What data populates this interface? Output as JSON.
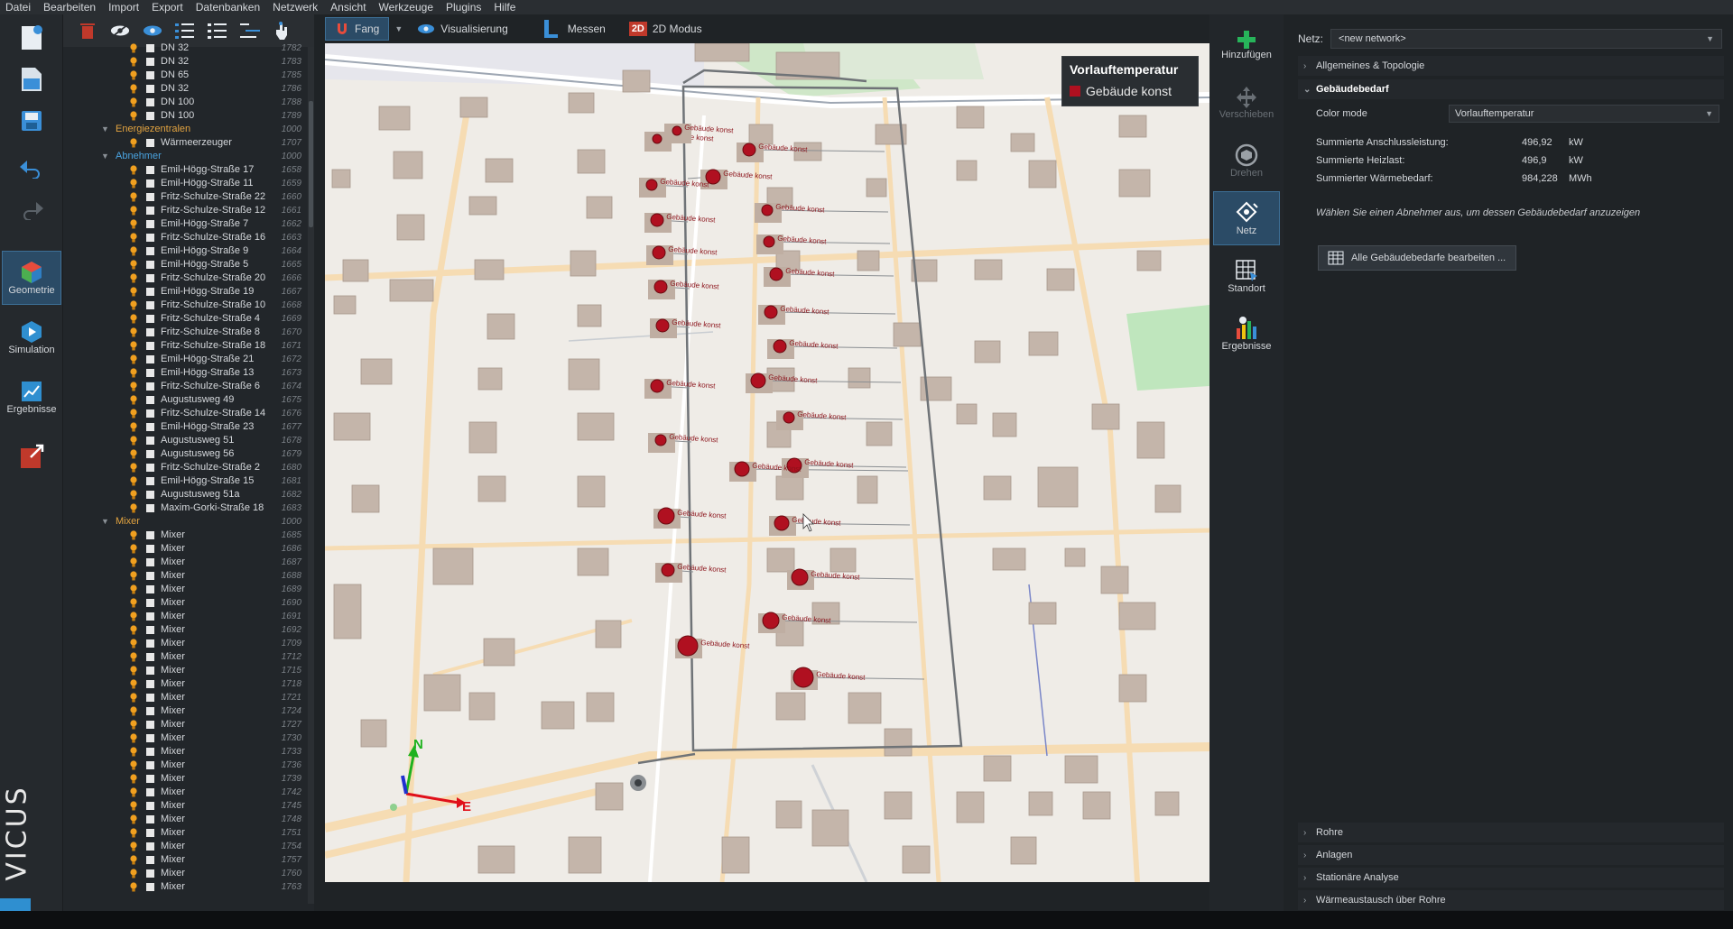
{
  "menu": [
    "Datei",
    "Bearbeiten",
    "Import",
    "Export",
    "Datenbanken",
    "Netzwerk",
    "Ansicht",
    "Werkzeuge",
    "Plugins",
    "Hilfe"
  ],
  "left_modes": [
    {
      "label": "Geometrie",
      "icon": "geometry-icon",
      "active": true
    },
    {
      "label": "Simulation",
      "icon": "simulation-icon",
      "active": false
    },
    {
      "label": "Ergebnisse",
      "icon": "results-icon",
      "active": false
    }
  ],
  "brand": "VICUS",
  "view_toolbar": {
    "fang": "Fang",
    "visualisierung": "Visualisierung",
    "messen": "Messen",
    "modus": "2D Modus",
    "modus_badge": "2D"
  },
  "tree": [
    {
      "type": "item",
      "label": "DN 32",
      "id": "1782"
    },
    {
      "type": "item",
      "label": "DN 32",
      "id": "1783"
    },
    {
      "type": "item",
      "label": "DN 65",
      "id": "1785"
    },
    {
      "type": "item",
      "label": "DN 32",
      "id": "1786"
    },
    {
      "type": "item",
      "label": "DN 100",
      "id": "1788"
    },
    {
      "type": "item",
      "label": "DN 100",
      "id": "1789"
    },
    {
      "type": "group",
      "label": "Energiezentralen",
      "id": "1000",
      "color": "orange"
    },
    {
      "type": "item",
      "label": "Wärmeerzeuger",
      "id": "1707"
    },
    {
      "type": "group",
      "label": "Abnehmer",
      "id": "1000",
      "color": "blue"
    },
    {
      "type": "item",
      "label": "Emil-Högg-Straße 17",
      "id": "1658"
    },
    {
      "type": "item",
      "label": "Emil-Högg-Straße 11",
      "id": "1659"
    },
    {
      "type": "item",
      "label": "Fritz-Schulze-Straße 22",
      "id": "1660"
    },
    {
      "type": "item",
      "label": "Fritz-Schulze-Straße 12",
      "id": "1661"
    },
    {
      "type": "item",
      "label": "Emil-Högg-Straße 7",
      "id": "1662"
    },
    {
      "type": "item",
      "label": "Fritz-Schulze-Straße 16",
      "id": "1663"
    },
    {
      "type": "item",
      "label": "Emil-Högg-Straße 9",
      "id": "1664"
    },
    {
      "type": "item",
      "label": "Emil-Högg-Straße 5",
      "id": "1665"
    },
    {
      "type": "item",
      "label": "Fritz-Schulze-Straße 20",
      "id": "1666"
    },
    {
      "type": "item",
      "label": "Emil-Högg-Straße 19",
      "id": "1667"
    },
    {
      "type": "item",
      "label": "Fritz-Schulze-Straße 10",
      "id": "1668"
    },
    {
      "type": "item",
      "label": "Fritz-Schulze-Straße 4",
      "id": "1669"
    },
    {
      "type": "item",
      "label": "Fritz-Schulze-Straße 8",
      "id": "1670"
    },
    {
      "type": "item",
      "label": "Fritz-Schulze-Straße 18",
      "id": "1671"
    },
    {
      "type": "item",
      "label": "Emil-Högg-Straße 21",
      "id": "1672"
    },
    {
      "type": "item",
      "label": "Emil-Högg-Straße 13",
      "id": "1673"
    },
    {
      "type": "item",
      "label": "Fritz-Schulze-Straße 6",
      "id": "1674"
    },
    {
      "type": "item",
      "label": "Augustusweg 49",
      "id": "1675"
    },
    {
      "type": "item",
      "label": "Fritz-Schulze-Straße 14",
      "id": "1676"
    },
    {
      "type": "item",
      "label": "Emil-Högg-Straße 23",
      "id": "1677"
    },
    {
      "type": "item",
      "label": "Augustusweg 51",
      "id": "1678"
    },
    {
      "type": "item",
      "label": "Augustusweg 56",
      "id": "1679"
    },
    {
      "type": "item",
      "label": "Fritz-Schulze-Straße 2",
      "id": "1680"
    },
    {
      "type": "item",
      "label": "Emil-Högg-Straße 15",
      "id": "1681"
    },
    {
      "type": "item",
      "label": "Augustusweg 51a",
      "id": "1682"
    },
    {
      "type": "item",
      "label": "Maxim-Gorki-Straße 18",
      "id": "1683"
    },
    {
      "type": "group",
      "label": "Mixer",
      "id": "1000",
      "color": "orange"
    },
    {
      "type": "item",
      "label": "Mixer",
      "id": "1685"
    },
    {
      "type": "item",
      "label": "Mixer",
      "id": "1686"
    },
    {
      "type": "item",
      "label": "Mixer",
      "id": "1687"
    },
    {
      "type": "item",
      "label": "Mixer",
      "id": "1688"
    },
    {
      "type": "item",
      "label": "Mixer",
      "id": "1689"
    },
    {
      "type": "item",
      "label": "Mixer",
      "id": "1690"
    },
    {
      "type": "item",
      "label": "Mixer",
      "id": "1691"
    },
    {
      "type": "item",
      "label": "Mixer",
      "id": "1692"
    },
    {
      "type": "item",
      "label": "Mixer",
      "id": "1709"
    },
    {
      "type": "item",
      "label": "Mixer",
      "id": "1712"
    },
    {
      "type": "item",
      "label": "Mixer",
      "id": "1715"
    },
    {
      "type": "item",
      "label": "Mixer",
      "id": "1718"
    },
    {
      "type": "item",
      "label": "Mixer",
      "id": "1721"
    },
    {
      "type": "item",
      "label": "Mixer",
      "id": "1724"
    },
    {
      "type": "item",
      "label": "Mixer",
      "id": "1727"
    },
    {
      "type": "item",
      "label": "Mixer",
      "id": "1730"
    },
    {
      "type": "item",
      "label": "Mixer",
      "id": "1733"
    },
    {
      "type": "item",
      "label": "Mixer",
      "id": "1736"
    },
    {
      "type": "item",
      "label": "Mixer",
      "id": "1739"
    },
    {
      "type": "item",
      "label": "Mixer",
      "id": "1742"
    },
    {
      "type": "item",
      "label": "Mixer",
      "id": "1745"
    },
    {
      "type": "item",
      "label": "Mixer",
      "id": "1748"
    },
    {
      "type": "item",
      "label": "Mixer",
      "id": "1751"
    },
    {
      "type": "item",
      "label": "Mixer",
      "id": "1754"
    },
    {
      "type": "item",
      "label": "Mixer",
      "id": "1757"
    },
    {
      "type": "item",
      "label": "Mixer",
      "id": "1760"
    },
    {
      "type": "item",
      "label": "Mixer",
      "id": "1763"
    }
  ],
  "legend": {
    "title": "Vorlauftemperatur",
    "entry": "Gebäude konst",
    "color": "#b01020"
  },
  "map_building_label": "Gebäude konst",
  "compass": {
    "north": "N",
    "east": "E"
  },
  "right_modes": [
    {
      "label": "Hinzufügen",
      "icon": "plus-icon",
      "state": "normal"
    },
    {
      "label": "Verschieben",
      "icon": "move-icon",
      "state": "dim"
    },
    {
      "label": "Drehen",
      "icon": "rotate-icon",
      "state": "dim"
    },
    {
      "label": "Netz",
      "icon": "network-icon",
      "state": "active"
    },
    {
      "label": "Standort",
      "icon": "location-icon",
      "state": "normal"
    },
    {
      "label": "Ergebnisse",
      "icon": "results-icon",
      "state": "normal"
    }
  ],
  "props": {
    "net_label": "Netz:",
    "net_value": "<new network>",
    "sect_general": "Allgemeines & Topologie",
    "sect_demand": "Gebäudebedarf",
    "color_mode_label": "Color mode",
    "color_mode_value": "Vorlauftemperatur",
    "rows": [
      {
        "label": "Summierte Anschlussleistung:",
        "value": "496,92",
        "unit": "kW"
      },
      {
        "label": "Summierte Heizlast:",
        "value": "496,9",
        "unit": "kW"
      },
      {
        "label": "Summierter Wärmebedarf:",
        "value": "984,228",
        "unit": "MWh"
      }
    ],
    "hint": "Wählen Sie einen Abnehmer aus, um dessen Gebäudebedarf anzuzeigen",
    "edit_button": "Alle Gebäudebedarfe bearbeiten ...",
    "bottom_sections": [
      "Rohre",
      "Anlagen",
      "Stationäre Analyse",
      "Wärmeaustausch über Rohre"
    ]
  }
}
